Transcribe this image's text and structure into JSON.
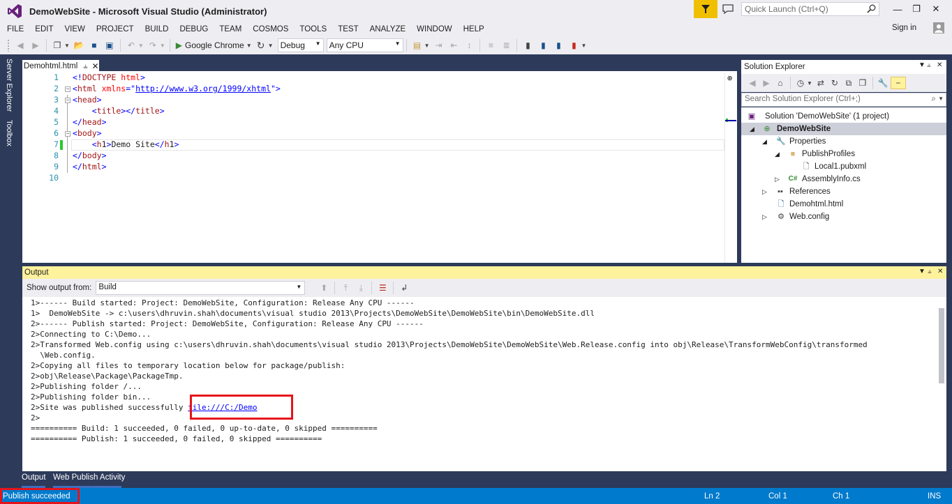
{
  "window": {
    "title": "DemoWebSite - Microsoft Visual Studio (Administrator)",
    "quick_launch_placeholder": "Quick Launch (Ctrl+Q)"
  },
  "menu": [
    "FILE",
    "EDIT",
    "VIEW",
    "PROJECT",
    "BUILD",
    "DEBUG",
    "TEAM",
    "COSMOS",
    "TOOLS",
    "TEST",
    "ANALYZE",
    "WINDOW",
    "HELP"
  ],
  "signin_label": "Sign in",
  "toolbar": {
    "run_target": "Google Chrome",
    "configuration": "Debug",
    "platform": "Any CPU"
  },
  "side_tabs": [
    "Server Explorer",
    "Toolbox"
  ],
  "editor": {
    "tab_label": "Demohtml.html",
    "current_line": 7,
    "lines": [
      "<!DOCTYPE html>",
      "<html xmlns=\"http://www.w3.org/1999/xhtml\">",
      "<head>",
      "    <title></title>",
      "</head>",
      "<body>",
      "    <h1>Demo Site</h1>",
      "</body>",
      "</html>",
      ""
    ],
    "line_numbers": [
      "1",
      "2",
      "3",
      "4",
      "5",
      "6",
      "7",
      "8",
      "9",
      "10"
    ]
  },
  "solution_explorer": {
    "title": "Solution Explorer",
    "search_placeholder": "Search Solution Explorer (Ctrl+;)",
    "items": [
      {
        "label": "Solution 'DemoWebSite' (1 project)",
        "icon": "solution-icon"
      },
      {
        "label": "DemoWebSite",
        "icon": "website-project-icon"
      },
      {
        "label": "Properties",
        "icon": "wrench-icon"
      },
      {
        "label": "PublishProfiles",
        "icon": "folder-icon"
      },
      {
        "label": "Local1.pubxml",
        "icon": "file-icon"
      },
      {
        "label": "AssemblyInfo.cs",
        "icon": "csharp-file-icon"
      },
      {
        "label": "References",
        "icon": "references-icon"
      },
      {
        "label": "Demohtml.html",
        "icon": "html-file-icon"
      },
      {
        "label": "Web.config",
        "icon": "config-file-icon"
      }
    ]
  },
  "output": {
    "title": "Output",
    "show_output_from_label": "Show output from:",
    "source": "Build",
    "lines": [
      "1>------ Build started: Project: DemoWebSite, Configuration: Release Any CPU ------",
      "1>  DemoWebSite -> c:\\users\\dhruvin.shah\\documents\\visual studio 2013\\Projects\\DemoWebSite\\DemoWebSite\\bin\\DemoWebSite.dll",
      "2>------ Publish started: Project: DemoWebSite, Configuration: Release Any CPU ------",
      "2>Connecting to C:\\Demo...",
      "2>Transformed Web.config using c:\\users\\dhruvin.shah\\documents\\visual studio 2013\\Projects\\DemoWebSite\\DemoWebSite\\Web.Release.config into obj\\Release\\TransformWebConfig\\transformed",
      "  \\Web.config.",
      "2>Copying all files to temporary location below for package/publish:",
      "2>obj\\Release\\Package\\PackageTmp.",
      "2>Publishing folder /...",
      "2>Publishing folder bin...",
      "2>Site was published successfully ",
      "2>",
      "========== Build: 1 succeeded, 0 failed, 0 up-to-date, 0 skipped ==========",
      "========== Publish: 1 succeeded, 0 failed, 0 skipped =========="
    ],
    "published_link": "file:///C:/Demo"
  },
  "bottom_tabs": [
    "Output",
    "Web Publish Activity"
  ],
  "status": {
    "message": "Publish succeeded",
    "ln": "Ln 2",
    "col": "Col 1",
    "ch": "Ch 1",
    "mode": "INS"
  },
  "colors": {
    "status_bar": "#007acc",
    "output_header": "#fff29d",
    "highlight_box": "#e5141b"
  }
}
